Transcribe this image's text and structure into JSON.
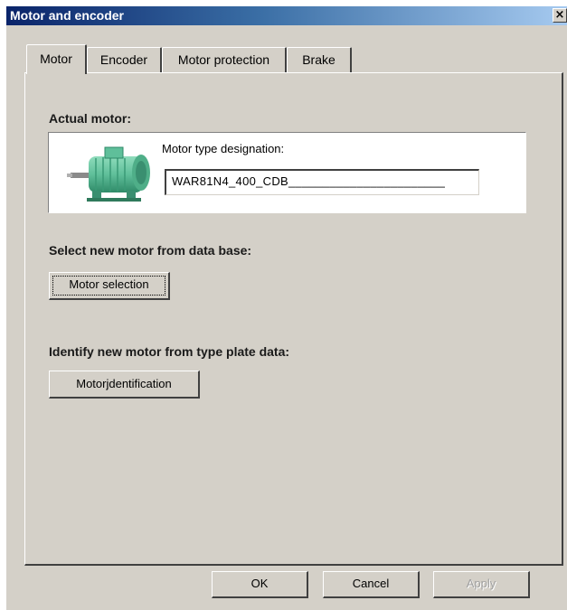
{
  "window": {
    "title": "Motor and encoder",
    "close_glyph": "×"
  },
  "tabs": [
    {
      "label": "Motor",
      "active": true
    },
    {
      "label": "Encoder",
      "active": false
    },
    {
      "label": "Motor protection",
      "active": false
    },
    {
      "label": "Brake",
      "active": false
    }
  ],
  "motor_tab": {
    "actual_motor_heading": "Actual motor:",
    "motor_image_icon": "motor-icon",
    "type_designation_label": "Motor type designation:",
    "type_designation_value": "WAR81N4_400_CDB_______________________",
    "select_heading": "Select new motor from data base:",
    "motor_selection_button": "Motor selection",
    "identify_heading": "Identify new motor from type plate data:",
    "motor_identification_button": "Motorjdentification"
  },
  "footer": {
    "ok_button": "OK",
    "cancel_button": "Cancel",
    "apply_button": "Apply"
  },
  "colors": {
    "dialog_face": "#d4d0c8",
    "title_gradient_start": "#0a246a",
    "title_gradient_end": "#a6caf0",
    "motor_body": "#5fbf9a"
  }
}
